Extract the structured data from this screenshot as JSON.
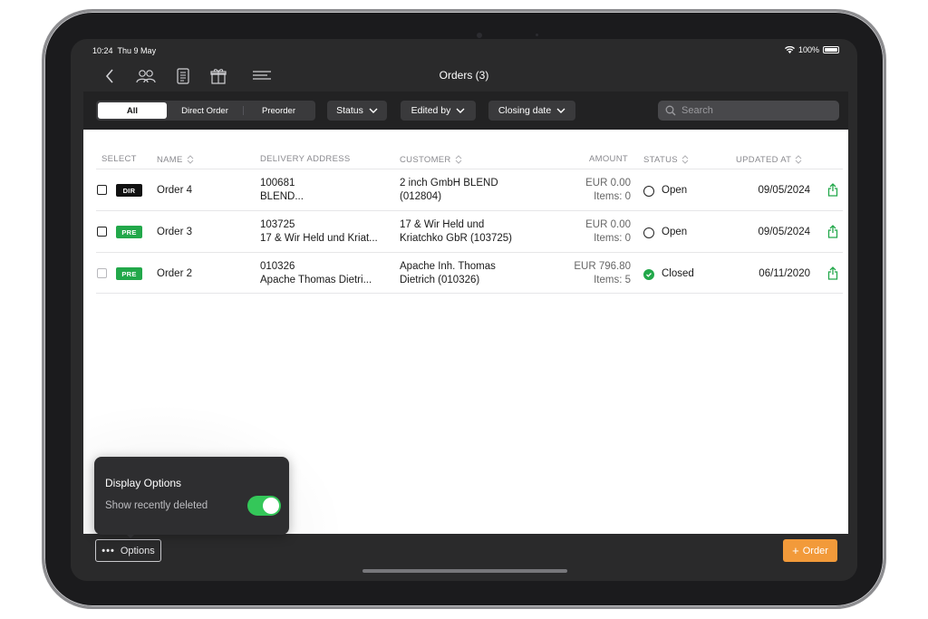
{
  "status_bar": {
    "time": "10:24",
    "date": "Thu 9 May",
    "battery": "100%"
  },
  "nav": {
    "title": "Orders (3)"
  },
  "filters": {
    "segments": [
      "All",
      "Direct Order",
      "Preorder"
    ],
    "status_label": "Status",
    "edited_by_label": "Edited by",
    "closing_date_label": "Closing date",
    "search_placeholder": "Search"
  },
  "table": {
    "headers": {
      "select": "SELECT",
      "name": "NAME",
      "delivery": "DELIVERY ADDRESS",
      "customer": "CUSTOMER",
      "amount": "AMOUNT",
      "status": "STATUS",
      "updated": "UPDATED AT"
    },
    "rows": [
      {
        "badge": "DIR",
        "name": "Order 4",
        "addr1": "100681",
        "addr2": "BLEND...",
        "cust1": "2 inch GmbH BLEND",
        "cust2": "(012804)",
        "amount": "EUR 0.00",
        "items": "Items: 0",
        "status": "Open",
        "updated": "09/05/2024"
      },
      {
        "badge": "PRE",
        "name": "Order 3",
        "addr1": "103725",
        "addr2": "17 & Wir Held und Kriat...",
        "cust1": "17 & Wir Held und",
        "cust2": "Kriatchko GbR (103725)",
        "amount": "EUR 0.00",
        "items": "Items: 0",
        "status": "Open",
        "updated": "09/05/2024"
      },
      {
        "badge": "PRE",
        "name": "Order 2",
        "addr1": "010326",
        "addr2": "Apache Thomas Dietri...",
        "cust1": "Apache Inh. Thomas",
        "cust2": "Dietrich (010326)",
        "amount": "EUR 796.80",
        "items": "Items: 5",
        "status": "Closed",
        "updated": "06/11/2020"
      }
    ]
  },
  "display_options": {
    "title": "Display Options",
    "show_deleted_label": "Show recently deleted",
    "show_deleted_on": true
  },
  "bottom": {
    "options_label": "Options",
    "order_label": "Order"
  },
  "colors": {
    "accent_green": "#22a84a",
    "order_orange": "#f29a3a",
    "toggle_green": "#34c759"
  }
}
